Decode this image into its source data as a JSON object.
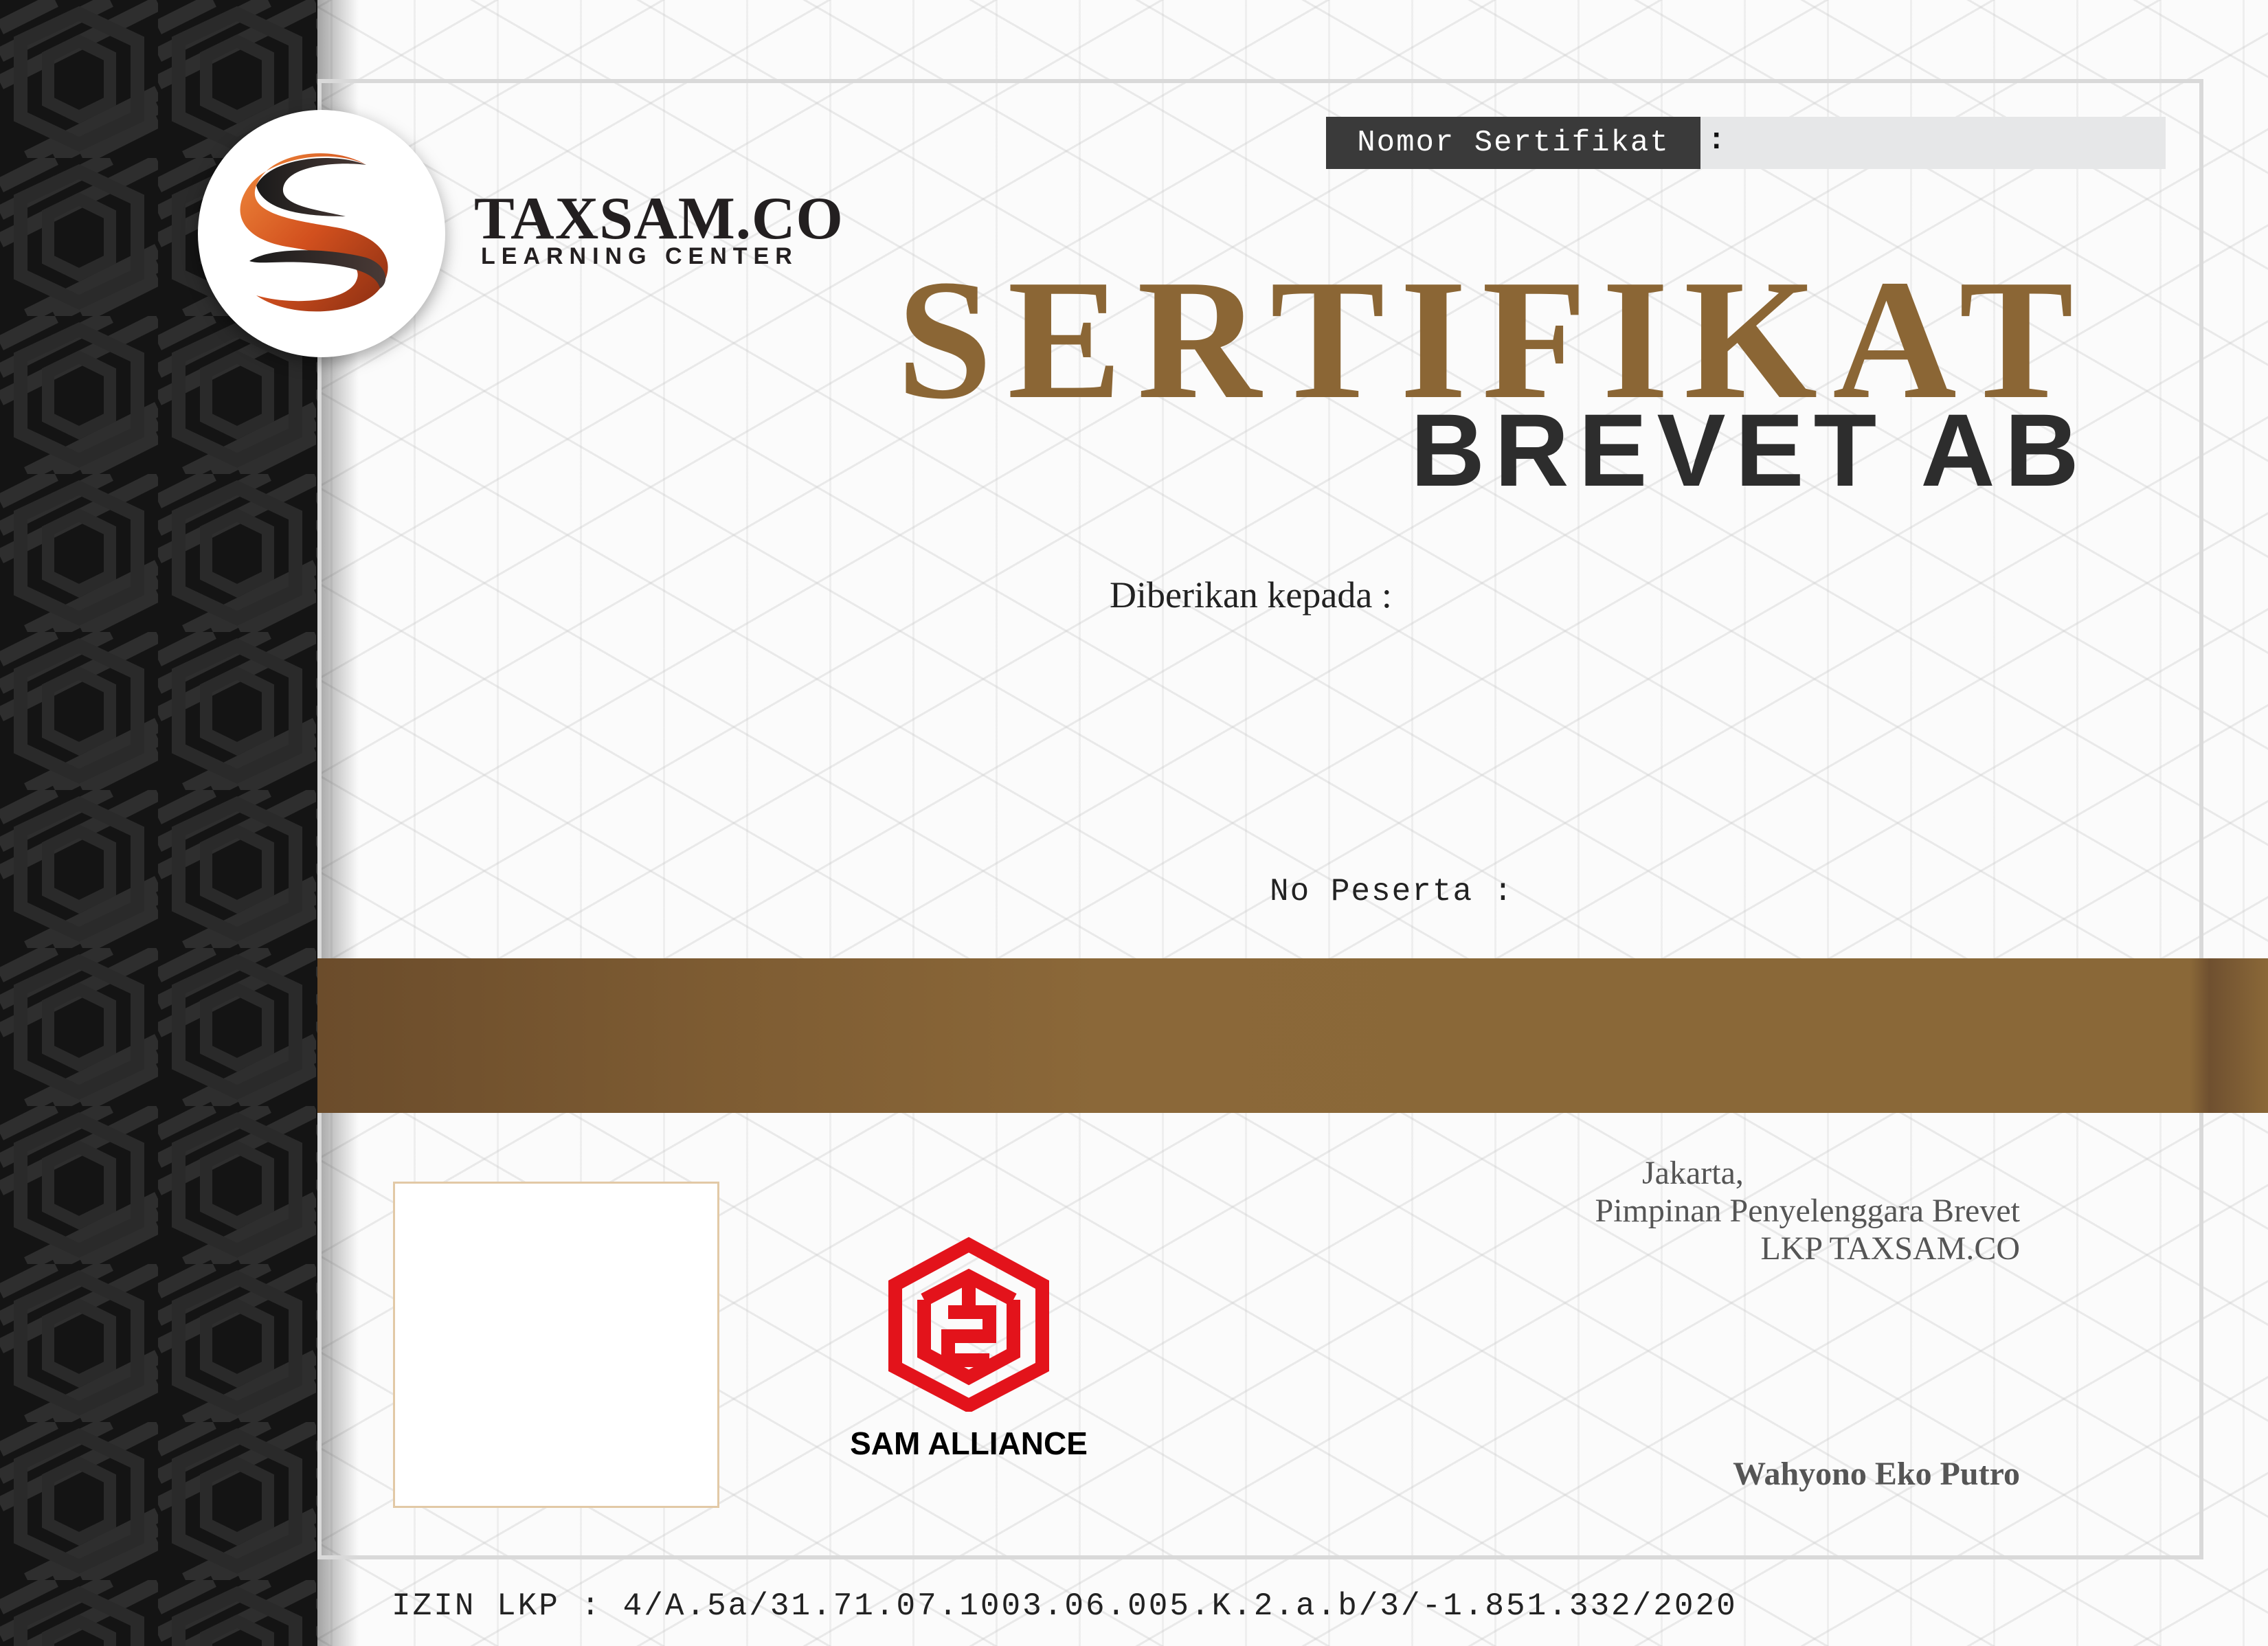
{
  "brand": {
    "name": "TAXSAM.CO",
    "tagline": "LEARNING CENTER"
  },
  "certificate_number": {
    "label": "Nomor Sertifikat",
    "separator": ":",
    "value": ""
  },
  "title": {
    "main": "SERTIFIKAT",
    "sub": "BREVET AB"
  },
  "recipient": {
    "label": "Diberikan kepada :",
    "name": ""
  },
  "participant": {
    "label": "No Peserta :",
    "value": ""
  },
  "partner": {
    "name": "SAM ALLIANCE"
  },
  "signature": {
    "city": "Jakarta,",
    "role": "Pimpinan Penyelenggara Brevet",
    "organization": "LKP TAXSAM.CO",
    "signer": "Wahyono Eko Putro"
  },
  "license": {
    "text": "IZIN LKP : 4/A.5a/31.71.07.1003.06.005.K.2.a.b/3/-1.851.332/2020"
  },
  "colors": {
    "gold": "#8b6635",
    "dark": "#2d2d2d",
    "band_black": "#111111",
    "partner_red": "#e3131b",
    "logo_orange": "#d2501e"
  },
  "icons": {
    "brand_logo": "taxsam-swirl-logo",
    "partner_logo": "sam-alliance-hex-logo"
  }
}
